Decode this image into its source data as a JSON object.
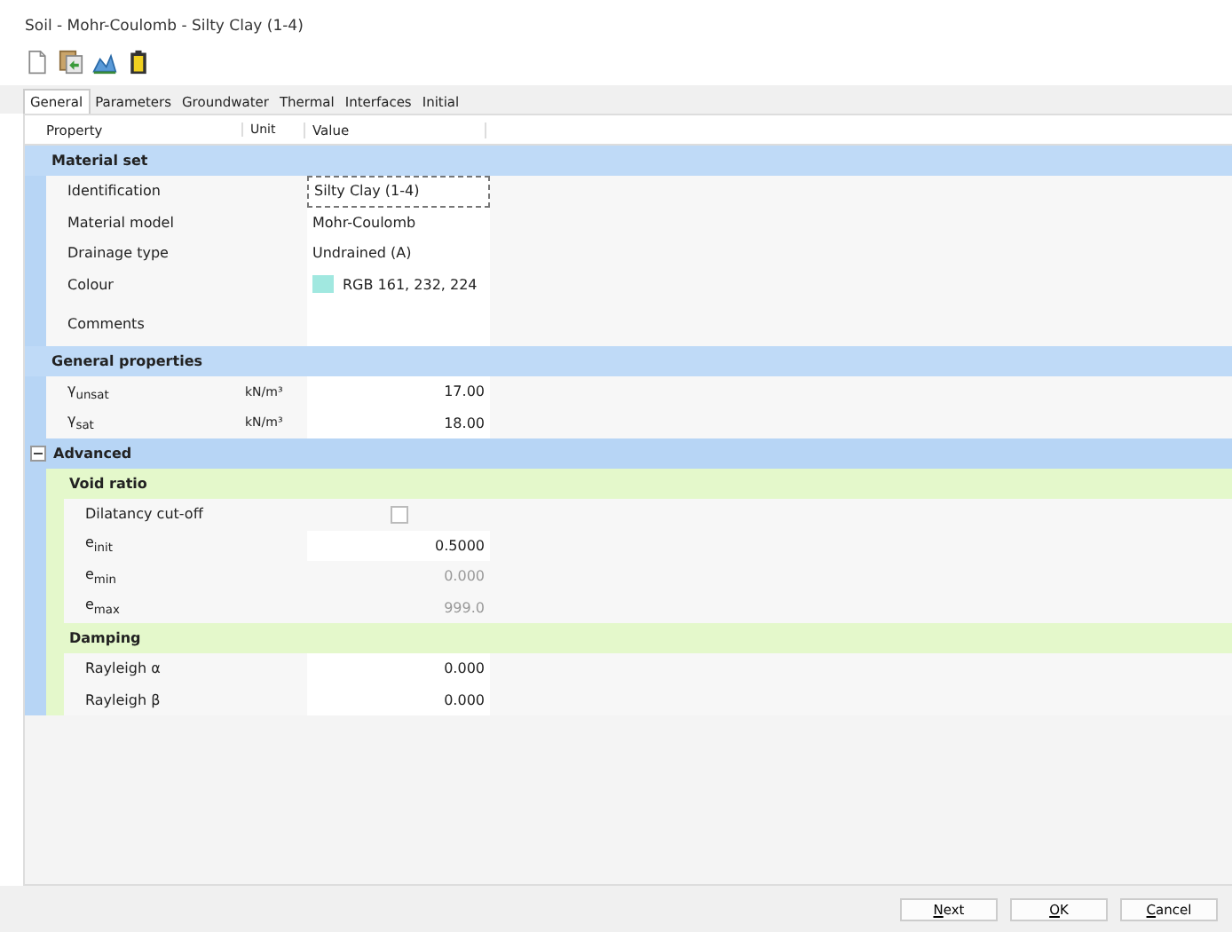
{
  "window": {
    "title": "Soil - Mohr-Coulomb - Silty Clay (1-4)"
  },
  "tabs": [
    {
      "label": "General",
      "selected": true
    },
    {
      "label": "Parameters",
      "selected": false
    },
    {
      "label": "Groundwater",
      "selected": false
    },
    {
      "label": "Thermal",
      "selected": false
    },
    {
      "label": "Interfaces",
      "selected": false
    },
    {
      "label": "Initial",
      "selected": false
    }
  ],
  "columns": [
    "Property",
    "Unit",
    "Value"
  ],
  "sections": [
    {
      "title": "Material set",
      "rows": [
        {
          "kind": "field",
          "label": "Identification",
          "value": "Silty Clay (1-4)",
          "focused": true
        },
        {
          "kind": "text",
          "label": "Material model",
          "value": "Mohr-Coulomb"
        },
        {
          "kind": "text",
          "label": "Drainage type",
          "value": "Undrained (A)"
        },
        {
          "kind": "colour",
          "label": "Colour",
          "value": "RGB 161, 232, 224",
          "color": "#a1e8e0"
        },
        {
          "kind": "memo",
          "label": "Comments"
        }
      ]
    },
    {
      "title": "General properties",
      "rows": [
        {
          "kind": "number",
          "label": "γ$_{unsat}$",
          "unit": "kN/m³",
          "value": "17.00"
        },
        {
          "kind": "number",
          "label": "γ$_{sat}$",
          "unit": "kN/m³",
          "value": "18.00"
        }
      ]
    }
  ],
  "advanced": {
    "title": "Advanced",
    "expanded": true,
    "sections": [
      {
        "title": "Void ratio",
        "rows": [
          {
            "kind": "checkbox",
            "label": "Dilatancy cut-off",
            "checked": false
          },
          {
            "kind": "number",
            "label": "e$_{init}$",
            "value": "0.5000"
          },
          {
            "kind": "readonly",
            "label": "e$_{min}$",
            "value": "0.000"
          },
          {
            "kind": "readonly",
            "label": "e$_{max}$",
            "value": "999.0"
          }
        ]
      },
      {
        "title": "Damping",
        "rows": [
          {
            "kind": "number",
            "label": "Rayleigh α",
            "value": "0.000"
          },
          {
            "kind": "number",
            "label": "Rayleigh β",
            "value": "0.000"
          }
        ]
      }
    ]
  },
  "buttons": [
    "Next",
    "OK",
    "Cancel"
  ]
}
